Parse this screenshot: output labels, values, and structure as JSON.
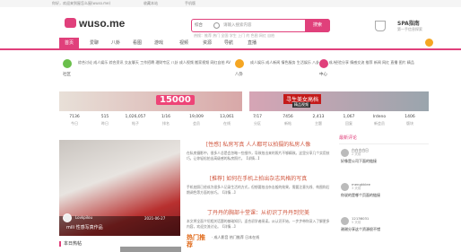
{
  "topbar": {
    "left": "你好，欢迎来到屋怎么屋(wuso.me)",
    "r1": "收藏本站",
    "r2": "手机版"
  },
  "logo": {
    "text": "wuso.me"
  },
  "search": {
    "category": "综合",
    "placeholder": "请输入搜索内容",
    "button": "搜索",
    "hot": "热搜：推荐 热门 全国 学生 上门 约 色图 网红 自拍"
  },
  "spa": {
    "title": "SPA指南",
    "subtitle": "第一手信息探索"
  },
  "nav": {
    "items": [
      "首页",
      "爱聊",
      "八卦",
      "看图",
      "游戏",
      "视频",
      "资源",
      "导航",
      "直播"
    ]
  },
  "categories": [
    {
      "label": "社区",
      "color": "#6abf4b",
      "links": "综合讨论  成人娱乐  综合资讯  交友聊天  工作招聘  理财专区  八卦  成人视频  搬家视频  网红自拍  AV  写真  成人漫画"
    },
    {
      "label": "八卦",
      "color": "#f5a623",
      "links": "成人娱乐  成人新闻  情色服务  生活娱乐  八卦  交友  成人电影  成人视频  情色写真"
    },
    {
      "label": "中心",
      "color": "#e0407b",
      "links": "经验分享  情感交流  推荐  新闻  网红  直播  图片  精品"
    }
  ],
  "banners": {
    "b1": "15000",
    "b2": "寻生美女高档",
    "b2sub": "精品视频"
  },
  "stats": [
    {
      "n": "7136",
      "k": "今日"
    },
    {
      "n": "515",
      "k": "昨日"
    },
    {
      "n": "1,026,057",
      "k": "帖子"
    },
    {
      "n": "1/16",
      "k": "排名"
    },
    {
      "n": "19,009",
      "k": "会员"
    },
    {
      "n": "13,061",
      "k": "在线"
    },
    {
      "n": "7/17",
      "k": "分区"
    },
    {
      "n": "7456",
      "k": "新帖"
    },
    {
      "n": "2,413",
      "k": "主题"
    },
    {
      "n": "1,067",
      "k": "回复"
    },
    {
      "n": "Irdeno",
      "k": "新会员"
    },
    {
      "n": "1406",
      "k": "版块"
    }
  ],
  "feature": {
    "name": "Lovkpilou",
    "date": "2021-06-27",
    "title": "mili 性感写真作品"
  },
  "articles": [
    {
      "h": "[性感] 私房写真 人人都可以拍摄的私房人像",
      "p": "在私房摄影中，很多人总是会忽略一些细节，导致拍出来的照片不够精致。这里分享几个实用技巧，让你轻松拍出高级感的私房照片。【详情...】"
    },
    {
      "h": "[推荐] 如何在手机上拍出杂志风格的写真",
      "p": "手机拍照已经成为很多人记录生活的方式，但想要拍出杂志般的效果，需要注意光线、构图和后期调色等方面的技巧。【详情...】"
    },
    {
      "h": "丁丹丹的胸部十堂课：从初识丁丹丹到完美",
      "p": "本文将全面介绍相关话题的基础知识，适合初学者阅读。从认识开始，一步步带你深入了解更多内容，欢迎交流讨论。【详情...】"
    }
  ],
  "hot": {
    "title": "热门推荐",
    "items": [
      "· 成人影音 热门推荐 日本在线"
    ]
  },
  "sidebar": {
    "title": "最新评论",
    "comments": [
      {
        "user": "白白白白日",
        "time": "2 天前",
        "text": "好像是公司下面的链接"
      },
      {
        "user": "mengkklee",
        "time": "3 天前",
        "text": "你说的是哪个页面的链接"
      },
      {
        "user": "12136031",
        "time": "5 天前",
        "text": "谢谢分享这个资源很不错"
      }
    ]
  },
  "bottom": {
    "title": "本日热帖"
  }
}
